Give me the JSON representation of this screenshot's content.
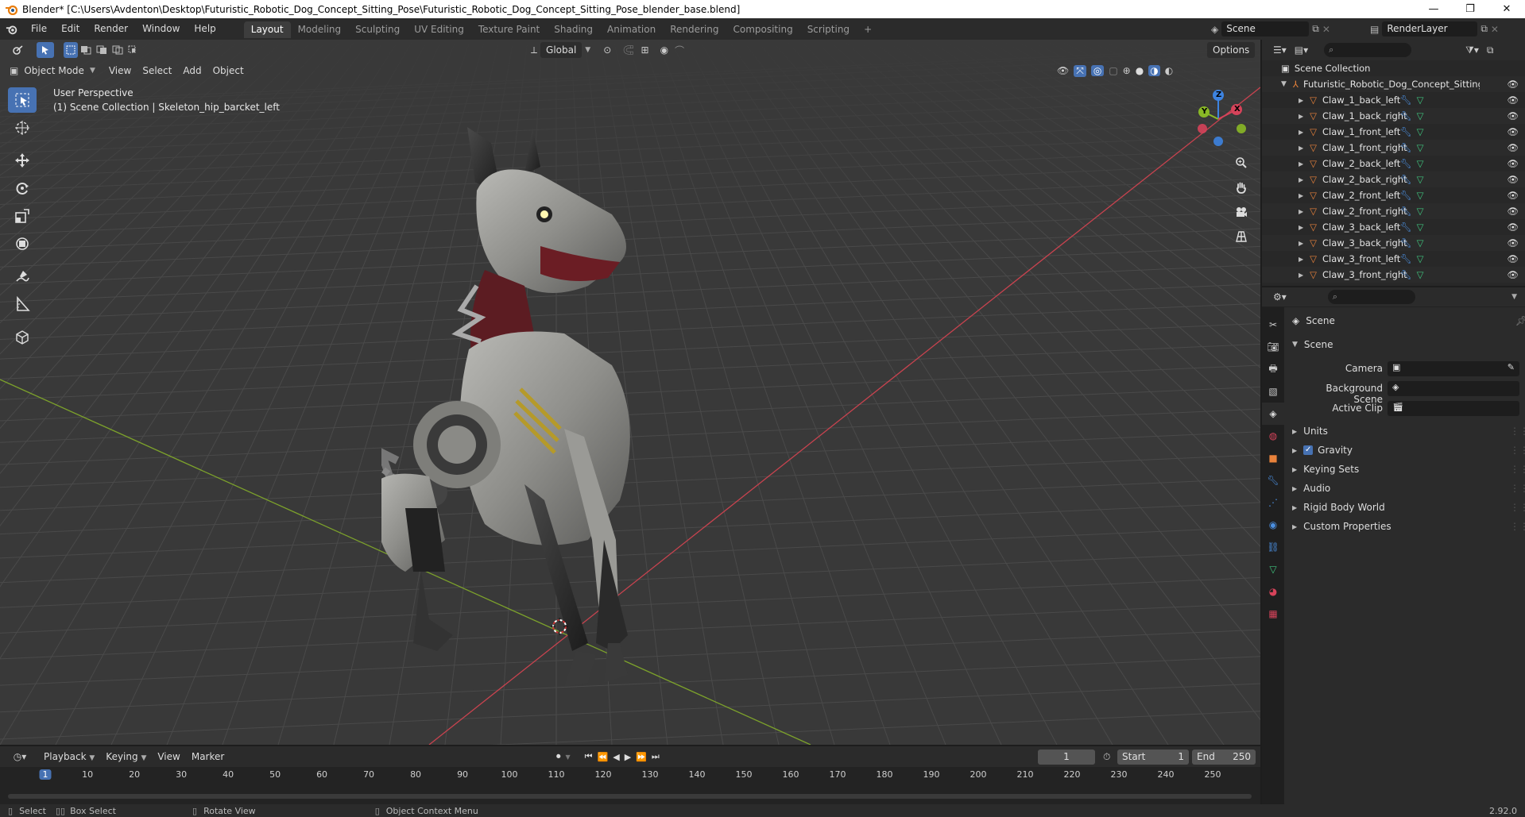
{
  "window": {
    "title": "Blender* [C:\\Users\\Avdenton\\Desktop\\Futuristic_Robotic_Dog_Concept_Sitting_Pose\\Futuristic_Robotic_Dog_Concept_Sitting_Pose_blender_base.blend]",
    "minimize": "—",
    "maximize": "❐",
    "close": "✕"
  },
  "menu": [
    "File",
    "Edit",
    "Render",
    "Window",
    "Help"
  ],
  "workspaces": [
    "Layout",
    "Modeling",
    "Sculpting",
    "UV Editing",
    "Texture Paint",
    "Shading",
    "Animation",
    "Rendering",
    "Compositing",
    "Scripting"
  ],
  "active_workspace": "Layout",
  "scene_selector": "Scene",
  "view_layer": "RenderLayer",
  "viewport": {
    "mode": "Object Mode",
    "menus": [
      "View",
      "Select",
      "Add",
      "Object"
    ],
    "transform_orientation": "Global",
    "options_label": "Options",
    "perspective_label": "User Perspective",
    "context_label": "(1) Scene Collection | Skeleton_hip_barcket_left",
    "gizmo": {
      "x": "X",
      "y": "Y",
      "z": "Z"
    }
  },
  "outliner": {
    "root": "Scene Collection",
    "collection": "Futuristic_Robotic_Dog_Concept_Sitting_Pos",
    "items": [
      "Claw_1_back_left",
      "Claw_1_back_right",
      "Claw_1_front_left",
      "Claw_1_front_right",
      "Claw_2_back_left",
      "Claw_2_back_right",
      "Claw_2_front_left",
      "Claw_2_front_right",
      "Claw_3_back_left",
      "Claw_3_back_right",
      "Claw_3_front_left",
      "Claw_3_front_right"
    ]
  },
  "properties": {
    "context": "Scene",
    "panel_title": "Scene",
    "fields": [
      {
        "label": "Camera"
      },
      {
        "label": "Background Scene"
      },
      {
        "label": "Active Clip"
      }
    ],
    "subpanels": [
      "Units",
      "Gravity",
      "Keying Sets",
      "Audio",
      "Rigid Body World",
      "Custom Properties"
    ],
    "gravity_checked": true
  },
  "timeline": {
    "menus": [
      "Playback",
      "Keying",
      "View",
      "Marker"
    ],
    "current_frame": "1",
    "start_label": "Start",
    "start": "1",
    "end_label": "End",
    "end": "250",
    "ruler": [
      "1",
      "10",
      "20",
      "30",
      "40",
      "50",
      "60",
      "70",
      "80",
      "90",
      "100",
      "110",
      "120",
      "130",
      "140",
      "150",
      "160",
      "170",
      "180",
      "190",
      "200",
      "210",
      "220",
      "230",
      "240",
      "250"
    ]
  },
  "statusbar": {
    "select": "Select",
    "box_select": "Box Select",
    "rotate": "Rotate View",
    "context_menu": "Object Context Menu",
    "version": "2.92.0"
  },
  "colors": {
    "accent": "#4772b3",
    "axis_x": "#d6435a",
    "axis_y": "#89b826",
    "axis_z": "#3d83e0",
    "mesh_icon": "#e8823b",
    "data_icon": "#3fc47e"
  }
}
